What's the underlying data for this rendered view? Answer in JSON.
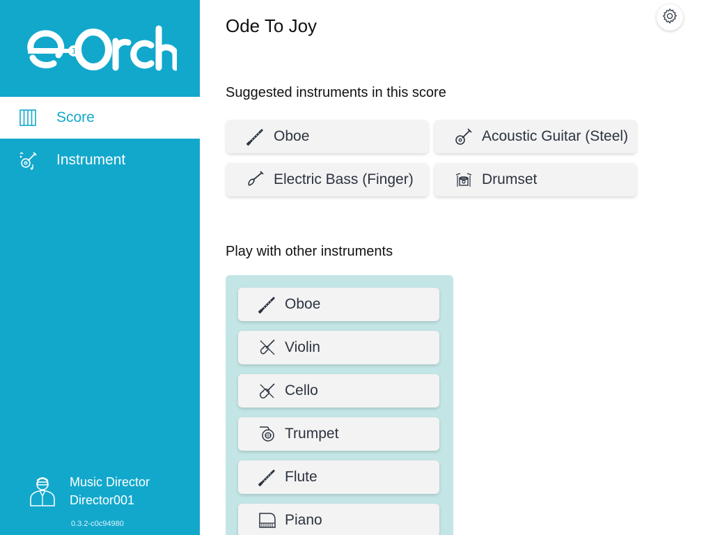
{
  "app": {
    "logo_text": "e-Orch"
  },
  "sidebar": {
    "nav": [
      {
        "label": "Score",
        "icon": "score-icon",
        "active": true
      },
      {
        "label": "Instrument",
        "icon": "instrument-icon",
        "active": false
      }
    ],
    "user": {
      "role": "Music Director",
      "name": "Director001"
    },
    "version": "0.3.2-c0c94980"
  },
  "main": {
    "title": "Ode To Joy",
    "suggested": {
      "heading": "Suggested instruments in this score",
      "items": [
        {
          "label": "Oboe",
          "icon": "oboe-icon"
        },
        {
          "label": "Acoustic Guitar (Steel)",
          "icon": "acoustic-guitar-icon"
        },
        {
          "label": "Electric Bass (Finger)",
          "icon": "electric-bass-icon"
        },
        {
          "label": "Drumset",
          "icon": "drumset-icon"
        }
      ]
    },
    "other": {
      "heading": "Play with other instruments",
      "items": [
        {
          "label": "Oboe",
          "icon": "oboe-icon"
        },
        {
          "label": "Violin",
          "icon": "violin-icon"
        },
        {
          "label": "Cello",
          "icon": "cello-icon"
        },
        {
          "label": "Trumpet",
          "icon": "trumpet-icon"
        },
        {
          "label": "Flute",
          "icon": "flute-icon"
        },
        {
          "label": "Piano",
          "icon": "piano-icon"
        }
      ]
    }
  },
  "colors": {
    "brand": "#12a8cc",
    "panel": "#c4e5e5",
    "card": "#f3f3f3",
    "icon": "#2c3340"
  }
}
